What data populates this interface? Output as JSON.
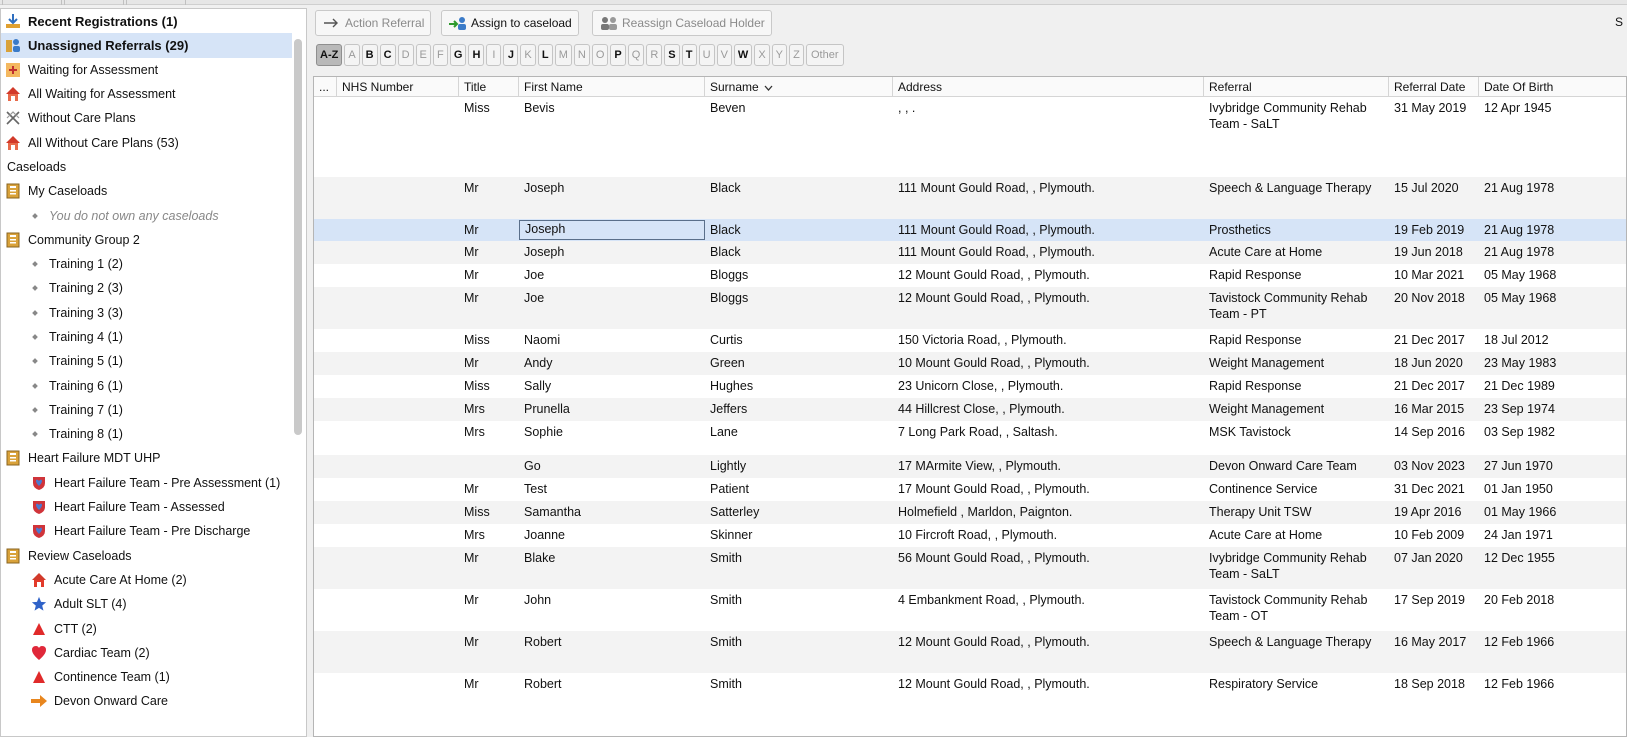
{
  "sidebar": {
    "items": [
      {
        "label": "Recent Registrations (1)",
        "icon": "download-arrow-icon",
        "style": "bold"
      },
      {
        "label": "Unassigned Referrals (29)",
        "icon": "unassigned-referrals-icon",
        "style": "bold",
        "selected": true
      },
      {
        "label": "Waiting for Assessment",
        "icon": "waiting-assessment-icon"
      },
      {
        "label": "All Waiting for Assessment",
        "icon": "house-icon"
      },
      {
        "label": "Without Care Plans",
        "icon": "no-care-plan-icon"
      },
      {
        "label": "All Without Care Plans (53)",
        "icon": "house-icon"
      },
      {
        "label": "Caseloads",
        "icon": "",
        "style": "header"
      },
      {
        "label": "My Caseloads",
        "icon": "book-icon"
      },
      {
        "label": "You do not own any caseloads",
        "icon": "",
        "style": "sub muted"
      },
      {
        "label": "Community Group 2",
        "icon": "book-icon"
      },
      {
        "label": "Training 1 (2)",
        "style": "sub"
      },
      {
        "label": "Training 2 (3)",
        "style": "sub"
      },
      {
        "label": "Training 3 (3)",
        "style": "sub"
      },
      {
        "label": "Training 4 (1)",
        "style": "sub"
      },
      {
        "label": "Training 5 (1)",
        "style": "sub"
      },
      {
        "label": "Training 6 (1)",
        "style": "sub"
      },
      {
        "label": "Training 7 (1)",
        "style": "sub"
      },
      {
        "label": "Training 8 (1)",
        "style": "sub"
      },
      {
        "label": "Heart Failure MDT UHP",
        "icon": "book-icon"
      },
      {
        "label": "Heart Failure Team - Pre Assessment (1)",
        "icon": "heart-shield-icon",
        "style": "l1"
      },
      {
        "label": "Heart Failure Team - Assessed",
        "icon": "heart-shield-icon",
        "style": "l1"
      },
      {
        "label": "Heart Failure Team - Pre Discharge",
        "icon": "heart-shield-icon",
        "style": "l1"
      },
      {
        "label": "Review Caseloads",
        "icon": "book-icon"
      },
      {
        "label": "Acute Care At Home (2)",
        "icon": "house-red-icon",
        "style": "l1"
      },
      {
        "label": "Adult SLT (4)",
        "icon": "star-icon",
        "style": "l1"
      },
      {
        "label": "CTT (2)",
        "icon": "triangle-icon",
        "style": "l1"
      },
      {
        "label": "Cardiac Team (2)",
        "icon": "heart-icon",
        "style": "l1"
      },
      {
        "label": "Continence Team (1)",
        "icon": "triangle-icon",
        "style": "l1"
      },
      {
        "label": "Devon Onward Care",
        "icon": "arrow-right-icon",
        "style": "l1"
      }
    ]
  },
  "toolbar": {
    "action_referral": "Action Referral",
    "assign_caseload": "Assign to caseload",
    "reassign_holder": "Reassign Caseload Holder",
    "right_stub": "S"
  },
  "alphabet": [
    "A-Z",
    "A",
    "B",
    "C",
    "D",
    "E",
    "F",
    "G",
    "H",
    "I",
    "J",
    "K",
    "L",
    "M",
    "N",
    "O",
    "P",
    "Q",
    "R",
    "S",
    "T",
    "U",
    "V",
    "W",
    "X",
    "Y",
    "Z",
    "Other"
  ],
  "alphabet_active": [
    "A-Z",
    "B",
    "C",
    "G",
    "H",
    "J",
    "L",
    "P",
    "S",
    "T",
    "W"
  ],
  "table": {
    "columns": [
      "...",
      "NHS Number",
      "Title",
      "First Name",
      "Surname",
      "Address",
      "Referral",
      "Referral Date",
      "Date Of Birth"
    ],
    "sort_column": "Surname",
    "rows": [
      {
        "nhs": "",
        "title": "Miss",
        "first": "Bevis",
        "surname": "Beven",
        "address": ", , .",
        "referral": "Ivybridge Community Rehab Team - SaLT",
        "ref_date": "31 May 2019",
        "dob": "12 Apr 1945"
      },
      {
        "nhs": "",
        "title": "Mr",
        "first": "Joseph",
        "surname": "Black",
        "address": "111 Mount Gould Road, , Plymouth.",
        "referral": "Speech & Language Therapy",
        "ref_date": "15 Jul 2020",
        "dob": "21 Aug 1978"
      },
      {
        "nhs": "",
        "title": "Mr",
        "first": "Joseph",
        "surname": "Black",
        "address": "111 Mount Gould Road, , Plymouth.",
        "referral": "Prosthetics",
        "ref_date": "19 Feb 2019",
        "dob": "21 Aug 1978",
        "selected": true
      },
      {
        "nhs": "",
        "title": "Mr",
        "first": "Joseph",
        "surname": "Black",
        "address": "111 Mount Gould Road, , Plymouth.",
        "referral": "Acute Care at Home",
        "ref_date": "19 Jun 2018",
        "dob": "21 Aug 1978"
      },
      {
        "nhs": "",
        "title": "Mr",
        "first": "Joe",
        "surname": "Bloggs",
        "address": "12 Mount Gould Road, , Plymouth.",
        "referral": "Rapid Response",
        "ref_date": "10 Mar 2021",
        "dob": "05 May 1968"
      },
      {
        "nhs": "",
        "title": "Mr",
        "first": "Joe",
        "surname": "Bloggs",
        "address": "12 Mount Gould Road, , Plymouth.",
        "referral": "Tavistock Community Rehab Team - PT",
        "ref_date": "20 Nov 2018",
        "dob": "05 May 1968"
      },
      {
        "nhs": "",
        "title": "Miss",
        "first": "Naomi",
        "surname": "Curtis",
        "address": "150  Victoria Road, , Plymouth.",
        "referral": "Rapid Response",
        "ref_date": "21 Dec 2017",
        "dob": "18 Jul 2012"
      },
      {
        "nhs": "",
        "title": "Mr",
        "first": "Andy",
        "surname": "Green",
        "address": "10 Mount Gould Road, , Plymouth.",
        "referral": "Weight Management",
        "ref_date": "18 Jun 2020",
        "dob": "23 May 1983"
      },
      {
        "nhs": "",
        "title": "Miss",
        "first": "Sally",
        "surname": "Hughes",
        "address": "23 Unicorn Close, , Plymouth.",
        "referral": "Rapid Response",
        "ref_date": "21 Dec 2017",
        "dob": "21 Dec 1989"
      },
      {
        "nhs": "",
        "title": "Mrs",
        "first": "Prunella",
        "surname": "Jeffers",
        "address": "44 Hillcrest Close, , Plymouth.",
        "referral": "Weight Management",
        "ref_date": "16 Mar 2015",
        "dob": "23 Sep 1974"
      },
      {
        "nhs": "",
        "title": "Mrs",
        "first": "Sophie",
        "surname": "Lane",
        "address": "7  Long Park Road, , Saltash.",
        "referral": "MSK Tavistock",
        "ref_date": "14 Sep 2016",
        "dob": "03 Sep 1982"
      },
      {
        "nhs": "",
        "title": "",
        "first": "Go",
        "surname": "Lightly",
        "address": "17  MArmite View, , Plymouth.",
        "referral": "Devon Onward Care Team",
        "ref_date": "03 Nov 2023",
        "dob": "27 Jun 1970"
      },
      {
        "nhs": "",
        "title": "Mr",
        "first": "Test",
        "surname": "Patient",
        "address": "17 Mount Gould Road, , Plymouth.",
        "referral": "Continence Service",
        "ref_date": "31 Dec 2021",
        "dob": "01 Jan 1950"
      },
      {
        "nhs": "",
        "title": "Miss",
        "first": "Samantha",
        "surname": "Satterley",
        "address": "Holmefield  , Marldon, Paignton.",
        "referral": "Therapy Unit TSW",
        "ref_date": "19 Apr 2016",
        "dob": "01 May 1966"
      },
      {
        "nhs": "",
        "title": "Mrs",
        "first": "Joanne",
        "surname": "Skinner",
        "address": "10 Fircroft Road, , Plymouth.",
        "referral": "Acute Care at Home",
        "ref_date": "10 Feb 2009",
        "dob": "24 Jan 1971"
      },
      {
        "nhs": "",
        "title": "Mr",
        "first": "Blake",
        "surname": "Smith",
        "address": "56  Mount Gould Road, , Plymouth.",
        "referral": "Ivybridge Community Rehab Team - SaLT",
        "ref_date": "07 Jan 2020",
        "dob": "12 Dec 1955"
      },
      {
        "nhs": "",
        "title": "Mr",
        "first": "John",
        "surname": "Smith",
        "address": "4  Embankment Road, , Plymouth.",
        "referral": "Tavistock Community Rehab Team - OT",
        "ref_date": "17 Sep 2019",
        "dob": "20 Feb 2018"
      },
      {
        "nhs": "",
        "title": "Mr",
        "first": "Robert",
        "surname": "Smith",
        "address": "12  Mount Gould Road, , Plymouth.",
        "referral": "Speech & Language Therapy",
        "ref_date": "16 May 2017",
        "dob": "12 Feb 1966"
      },
      {
        "nhs": "",
        "title": "Mr",
        "first": "Robert",
        "surname": "Smith",
        "address": "12  Mount Gould Road, , Plymouth.",
        "referral": "Respiratory Service",
        "ref_date": "18 Sep 2018",
        "dob": "12 Feb 1966"
      }
    ]
  }
}
